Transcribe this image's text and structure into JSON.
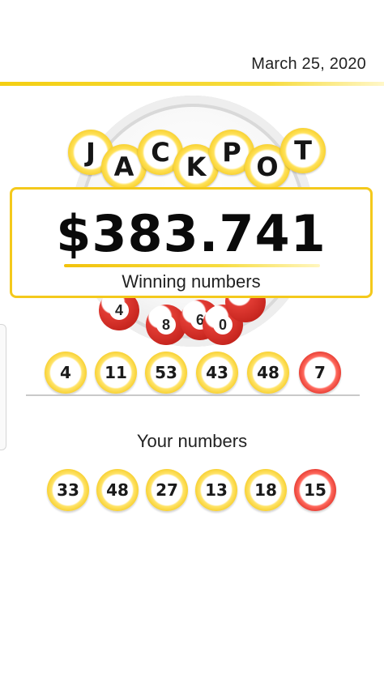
{
  "header": {
    "date": "March 25, 2020"
  },
  "jackpot": {
    "letters": [
      "J",
      "A",
      "C",
      "K",
      "P",
      "O",
      "T"
    ],
    "amount": "$383.741",
    "winning_label": "Winning numbers"
  },
  "drum": {
    "balls": [
      "4",
      "8",
      "6",
      "0"
    ]
  },
  "winning_numbers": [
    {
      "value": "4",
      "color": "yellow"
    },
    {
      "value": "11",
      "color": "yellow"
    },
    {
      "value": "53",
      "color": "yellow"
    },
    {
      "value": "43",
      "color": "yellow"
    },
    {
      "value": "48",
      "color": "yellow"
    },
    {
      "value": "7",
      "color": "red"
    }
  ],
  "your_label": "Your numbers",
  "your_numbers": [
    {
      "value": "33",
      "color": "yellow"
    },
    {
      "value": "48",
      "color": "yellow"
    },
    {
      "value": "27",
      "color": "yellow"
    },
    {
      "value": "13",
      "color": "yellow"
    },
    {
      "value": "18",
      "color": "yellow"
    },
    {
      "value": "15",
      "color": "red"
    }
  ],
  "colors": {
    "accent_yellow": "#f4c91c",
    "ball_red": "#d9241b"
  }
}
